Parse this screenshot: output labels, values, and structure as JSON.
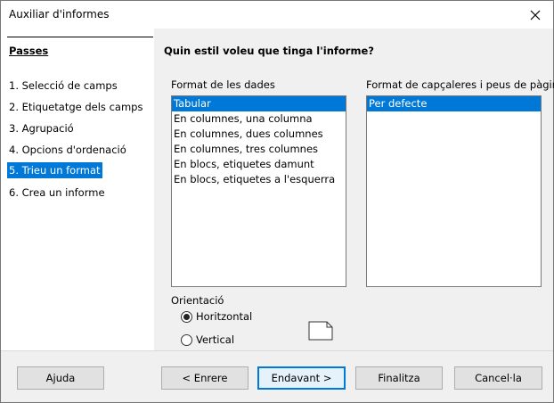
{
  "window": {
    "title": "Auxiliar d'informes"
  },
  "steps": {
    "header": "Passes",
    "items": [
      {
        "label": "1. Selecció de camps"
      },
      {
        "label": "2. Etiquetatge dels camps"
      },
      {
        "label": "3. Agrupació"
      },
      {
        "label": "4. Opcions d'ordenació"
      },
      {
        "label": "5. Trieu un format"
      },
      {
        "label": "6. Crea un informe"
      }
    ],
    "active_index": 4
  },
  "main": {
    "heading": "Quin estil voleu que tinga l'informe?",
    "data_format": {
      "label": "Format de les dades",
      "options": [
        "Tabular",
        "En columnes, una columna",
        "En columnes, dues columnes",
        "En columnes, tres columnes",
        "En blocs, etiquetes damunt",
        "En blocs, etiquetes a l'esquerra"
      ],
      "selected": "Tabular"
    },
    "header_footer": {
      "label": "Format de capçaleres i peus de pàgina",
      "options": [
        "Per defecte"
      ],
      "selected": "Per defecte"
    },
    "orientation": {
      "label": "Orientació",
      "options": [
        "Horitzontal",
        "Vertical"
      ],
      "selected": "Horitzontal"
    }
  },
  "footer": {
    "help": "Ajuda",
    "back": "< Enrere",
    "next": "Endavant >",
    "finish": "Finalitza",
    "cancel": "Cancel·la"
  },
  "icons": {
    "close": "close-icon",
    "page": "page-orientation-icon"
  },
  "colors": {
    "selection": "#0078d7",
    "default_button_border": "#0078d7"
  }
}
